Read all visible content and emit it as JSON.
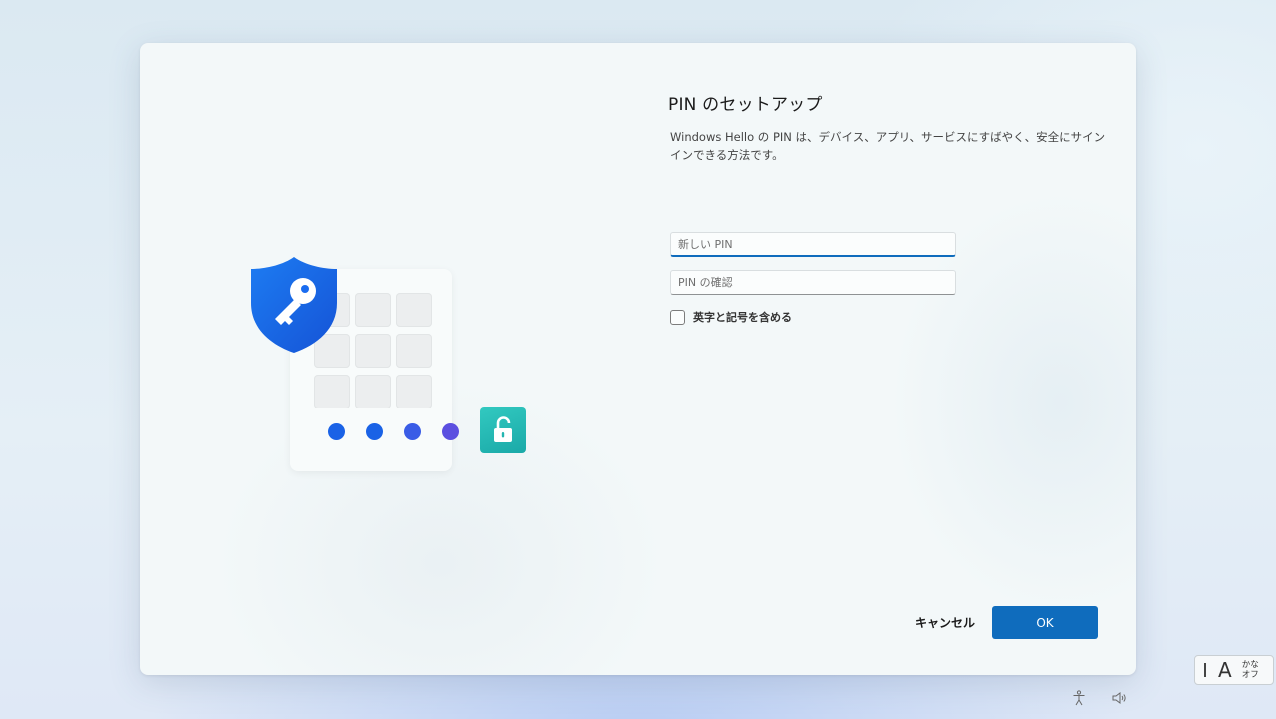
{
  "dialog": {
    "title": "PIN のセットアップ",
    "description": "Windows Hello の PIN は、デバイス、アプリ、サービスにすばやく、安全にサインインできる方法です。",
    "new_pin": {
      "placeholder": "新しい PIN",
      "value": ""
    },
    "confirm_pin": {
      "placeholder": "PIN の確認",
      "value": ""
    },
    "include_symbols": {
      "label": "英字と記号を含める",
      "checked": false
    },
    "cancel_label": "キャンセル",
    "ok_label": "OK"
  },
  "illustration": {
    "icons": [
      "shield-key-icon",
      "unlock-icon"
    ],
    "pin_dot_colors": [
      "#1a62e6",
      "#1a62e6",
      "#3a5ce6",
      "#5b4fe0"
    ],
    "shield_color": "#1a6cf0",
    "lock_color": "#22b5b0"
  },
  "ime": {
    "mode_glyph": "A",
    "kana_line1": "かな",
    "kana_line2": "オフ"
  },
  "system_icons": [
    "accessibility-icon",
    "volume-icon"
  ],
  "colors": {
    "accent": "#0f6cbd"
  }
}
